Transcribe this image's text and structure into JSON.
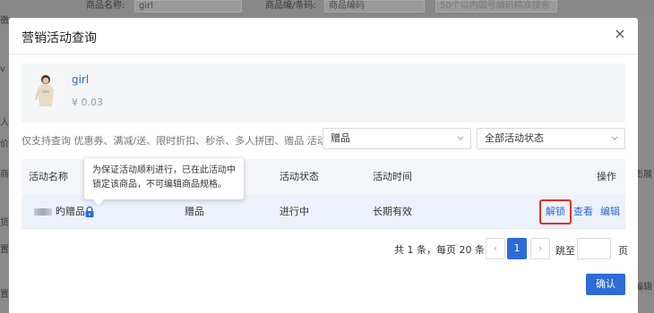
{
  "background": {
    "filter_label_1": "商品名称:",
    "filter_value_1": "girl",
    "filter_label_2": "商品编/条码:",
    "filter_value_2": "商品编码",
    "filter_placeholder_3": "50个以内国号编码精准搜索",
    "side_1": "徼",
    "side_2": "v",
    "side_3": "人",
    "side_4": "价",
    "side_5": "商品",
    "side_6": "货",
    "side_7": "置",
    "side_8": "置",
    "right_1": "点击展",
    "right_2": "编辑"
  },
  "modal": {
    "title": "营销活动查询",
    "close_symbol": "×",
    "product": {
      "name": "girl",
      "price": "¥ 0.03"
    },
    "support_text": "仅支持查询 优惠券、满减/送、限时折扣、秒杀、多人拼团、赠品 活动",
    "activity_type_select": "赠品",
    "activity_status_select": "全部活动状态",
    "table": {
      "headers": {
        "name": "活动名称",
        "status": "活动状态",
        "time": "活动时间",
        "actions": "操作"
      },
      "rows": [
        {
          "name_suffix": "旳赠品",
          "type": "赠品",
          "status": "进行中",
          "time": "长期有效",
          "action_unlock": "解锁",
          "action_view": "查看",
          "action_edit": "编辑"
        }
      ]
    },
    "tooltip": {
      "line1": "为保证活动顺利进行，已在此活动中",
      "line2": "锁定该商品，不可编辑商品规格。"
    },
    "pagination": {
      "summary": "共 1 条，每页 20 条",
      "prev": "‹",
      "current_page": "1",
      "next": "›",
      "goto_label": "跳至",
      "page_label": "页"
    },
    "confirm_label": "确认"
  },
  "colors": {
    "accent": "#2d6bd6",
    "highlight_border": "#e0301e"
  }
}
